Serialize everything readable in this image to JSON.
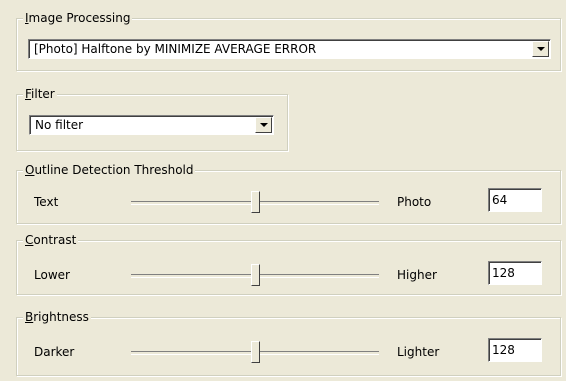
{
  "image_processing": {
    "legend_key": "I",
    "legend_rest": "mage Processing",
    "selected": "[Photo] Halftone by MINIMIZE AVERAGE ERROR",
    "dropdown_icon": "chevron-down-icon"
  },
  "filter": {
    "legend_key": "F",
    "legend_rest": "ilter",
    "selected": "No filter",
    "dropdown_icon": "chevron-down-icon"
  },
  "outline": {
    "legend_key": "O",
    "legend_rest": "utline Detection Threshold",
    "low_label": "Text",
    "high_label": "Photo",
    "value": "64",
    "slider_fraction": 0.5
  },
  "contrast": {
    "legend_key": "C",
    "legend_rest": "ontrast",
    "low_label": "Lower",
    "high_label": "Higher",
    "value": "128",
    "slider_fraction": 0.5
  },
  "brightness": {
    "legend_key": "B",
    "legend_rest": "rightness",
    "low_label": "Darker",
    "high_label": "Lighter",
    "value": "128",
    "slider_fraction": 0.5
  }
}
